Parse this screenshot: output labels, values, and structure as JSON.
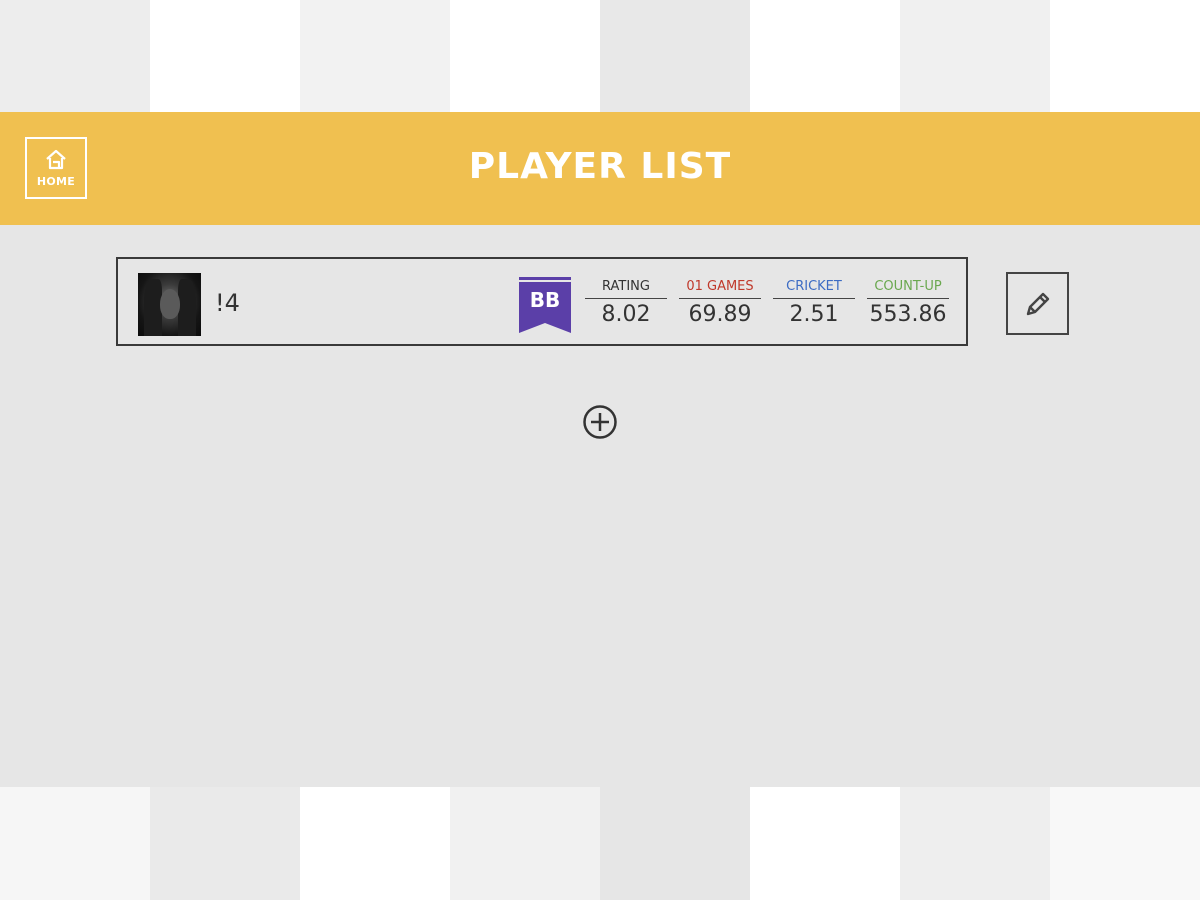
{
  "header": {
    "title": "PLAYER LIST",
    "home_label": "HOME",
    "background_color": "#f0c050"
  },
  "players": [
    {
      "name": "!4",
      "rank": "BB",
      "rank_color": "#5b3fa8",
      "stats": [
        {
          "label": "RATING",
          "value": "8.02",
          "color": "#333333"
        },
        {
          "label": "01 GAMES",
          "value": "69.89",
          "color": "#c0392b"
        },
        {
          "label": "CRICKET",
          "value": "2.51",
          "color": "#3d6cc4"
        },
        {
          "label": "COUNT-UP",
          "value": "553.86",
          "color": "#6aa84f"
        }
      ]
    }
  ],
  "icons": {
    "home": "home-icon",
    "edit": "pencil-icon",
    "add": "plus-circle-icon"
  }
}
